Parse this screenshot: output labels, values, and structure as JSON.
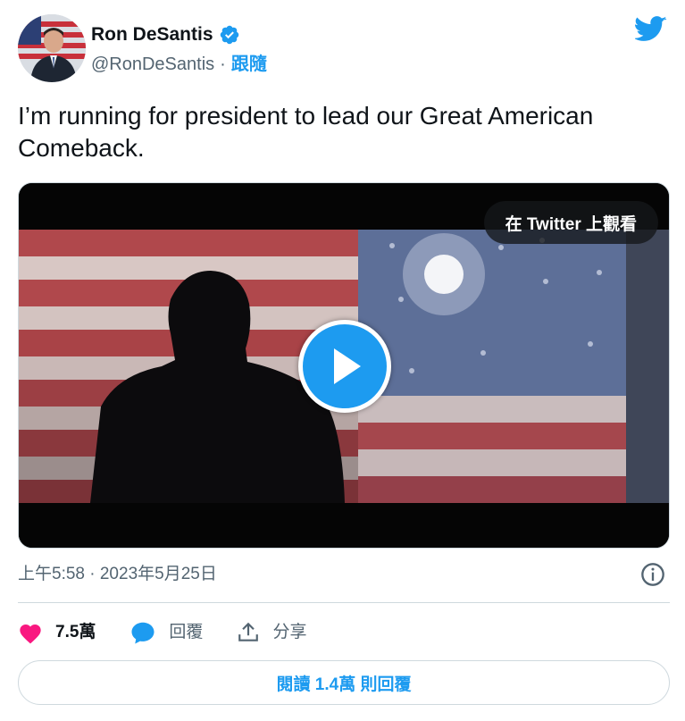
{
  "author": {
    "name": "Ron DeSantis",
    "handle": "@RonDeSantis",
    "separator": "·",
    "follow_label": "跟隨"
  },
  "tweet": {
    "text": "I’m running for president to lead our Great American Comeback."
  },
  "media": {
    "watch_label": "在 Twitter 上觀看"
  },
  "meta": {
    "timestamp": "上午5:58 · 2023年5月25日"
  },
  "actions": {
    "likes": "7.5萬",
    "reply_label": "回覆",
    "share_label": "分享"
  },
  "read_replies_label": "閱讀 1.4萬 則回覆",
  "colors": {
    "accent": "#1d9bf0",
    "like": "#f91880",
    "text": "#0f1419",
    "secondary": "#536471"
  }
}
